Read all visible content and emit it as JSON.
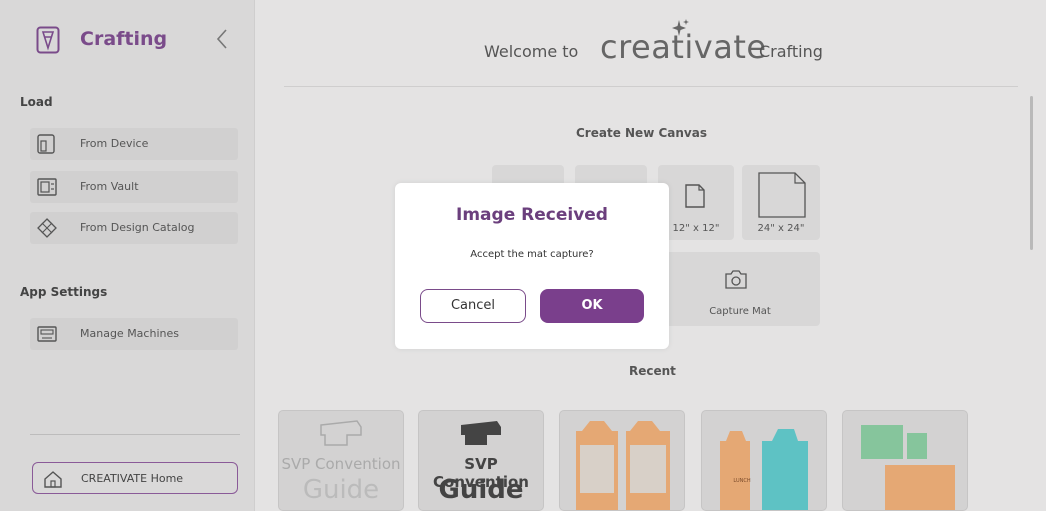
{
  "sidebar": {
    "title": "Crafting",
    "load_label": "Load",
    "load_items": [
      {
        "label": "From Device",
        "icon": "device-icon"
      },
      {
        "label": "From Vault",
        "icon": "vault-icon"
      },
      {
        "label": "From Design Catalog",
        "icon": "catalog-icon"
      }
    ],
    "app_settings_label": "App Settings",
    "settings_items": [
      {
        "label": "Manage Machines",
        "icon": "machine-icon"
      }
    ],
    "home_button": "CREATIVATE Home"
  },
  "header": {
    "welcome_prefix": "Welcome to",
    "brand": "creativate",
    "welcome_suffix": "Crafting"
  },
  "canvas": {
    "title": "Create New Canvas",
    "sizes": [
      "12\" x 12\"",
      "24\" x 24\""
    ],
    "capture_label": "Capture Mat"
  },
  "recent": {
    "title": "Recent",
    "cards": [
      {
        "line1": "SVP Convention",
        "line2": "Guide"
      },
      {
        "line1": "SVP Convention",
        "line2": "Guide"
      },
      {
        "label": ""
      },
      {
        "label": "LUNCH"
      },
      {
        "label": ""
      }
    ]
  },
  "dialog": {
    "title": "Image Received",
    "message": "Accept the mat capture?",
    "cancel": "Cancel",
    "ok": "OK"
  },
  "colors": {
    "accent": "#7a3f8c",
    "sidebar_bg": "#d9d8d8",
    "main_bg": "#e4e3e3"
  }
}
